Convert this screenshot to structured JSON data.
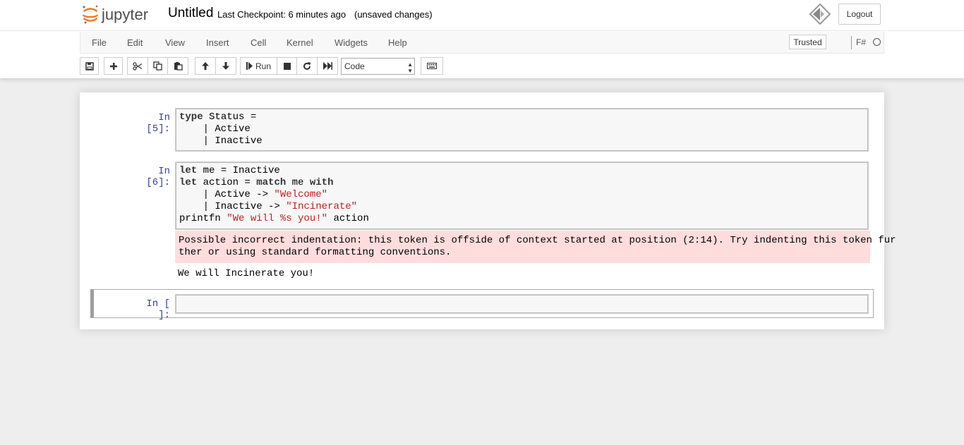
{
  "header": {
    "logo_text": "jupyter",
    "notebook_title": "Untitled",
    "checkpoint": "Last Checkpoint: 6 minutes ago",
    "status": "(unsaved changes)",
    "logout_label": "Logout"
  },
  "menubar": {
    "items": [
      "File",
      "Edit",
      "View",
      "Insert",
      "Cell",
      "Kernel",
      "Widgets",
      "Help"
    ],
    "trusted_label": "Trusted",
    "kernel_name": "F#"
  },
  "toolbar": {
    "run_label": "Run",
    "cell_type": "Code"
  },
  "cells": [
    {
      "prompt": "In [5]:",
      "code": [
        [
          {
            "t": "type",
            "c": "kw dark"
          },
          {
            "t": " Status =",
            "c": ""
          }
        ],
        [
          {
            "t": "    | Active",
            "c": ""
          }
        ],
        [
          {
            "t": "    | Inactive",
            "c": ""
          }
        ]
      ]
    },
    {
      "prompt": "In [6]:",
      "code": [
        [
          {
            "t": "let",
            "c": "kw dark"
          },
          {
            "t": " me = Inactive",
            "c": ""
          }
        ],
        [
          {
            "t": "let",
            "c": "kw dark"
          },
          {
            "t": " action = ",
            "c": ""
          },
          {
            "t": "match",
            "c": "kw dark"
          },
          {
            "t": " me ",
            "c": ""
          },
          {
            "t": "with",
            "c": "kw dark"
          }
        ],
        [
          {
            "t": "    | Active -> ",
            "c": ""
          },
          {
            "t": "\"Welcome\"",
            "c": "str"
          }
        ],
        [
          {
            "t": "    | Inactive -> ",
            "c": ""
          },
          {
            "t": "\"Incinerate\"",
            "c": "str"
          }
        ],
        [
          {
            "t": "printfn ",
            "c": ""
          },
          {
            "t": "\"We will %s you!\"",
            "c": "str"
          },
          {
            "t": " action",
            "c": ""
          }
        ]
      ],
      "stderr_lines": [
        "Possible incorrect indentation: this token is offside of context started at position (2:14). Try indenting this token fur",
        "ther or using standard formatting conventions."
      ],
      "stdout": "We will Incinerate you!"
    },
    {
      "prompt": "In [ ]:",
      "code": []
    }
  ],
  "colors": {
    "prompt": "#303f9f",
    "stderr_bg": "#ffdddd",
    "string": "#ba2121"
  }
}
